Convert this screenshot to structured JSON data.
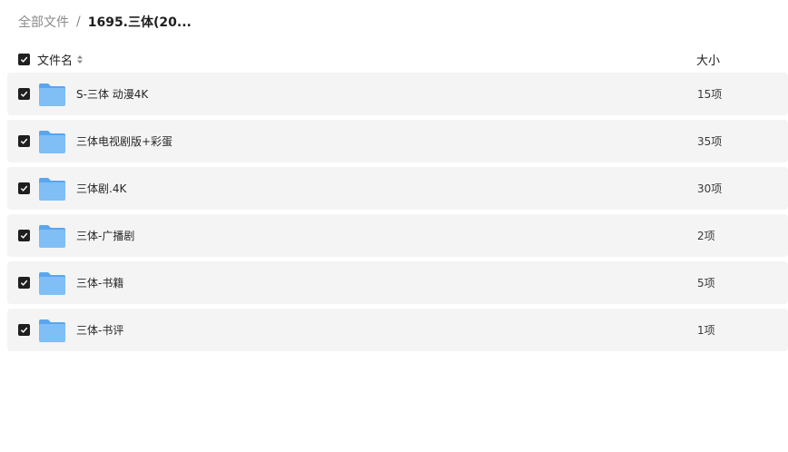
{
  "breadcrumb": {
    "root": "全部文件",
    "separator": "/",
    "current": "1695.三体(20..."
  },
  "table": {
    "columns": {
      "name": "文件名",
      "size": "大小"
    },
    "rows": [
      {
        "name": "S-三体 动漫4K",
        "size": "15项",
        "icon": "folder-icon",
        "checked": true
      },
      {
        "name": "三体电视剧版+彩蛋",
        "size": "35项",
        "icon": "folder-icon",
        "checked": true
      },
      {
        "name": "三体剧.4K",
        "size": "30项",
        "icon": "folder-icon",
        "checked": true
      },
      {
        "name": "三体-广播剧",
        "size": "2项",
        "icon": "folder-icon",
        "checked": true
      },
      {
        "name": "三体-书籍",
        "size": "5项",
        "icon": "folder-icon",
        "checked": true
      },
      {
        "name": "三体-书评",
        "size": "1项",
        "icon": "folder-icon",
        "checked": true
      }
    ]
  },
  "colors": {
    "checkbox": "#1f1f1f",
    "row_background": "#f4f4f4",
    "folder_front": "#7fbff5",
    "folder_back": "#5aa6ee"
  }
}
